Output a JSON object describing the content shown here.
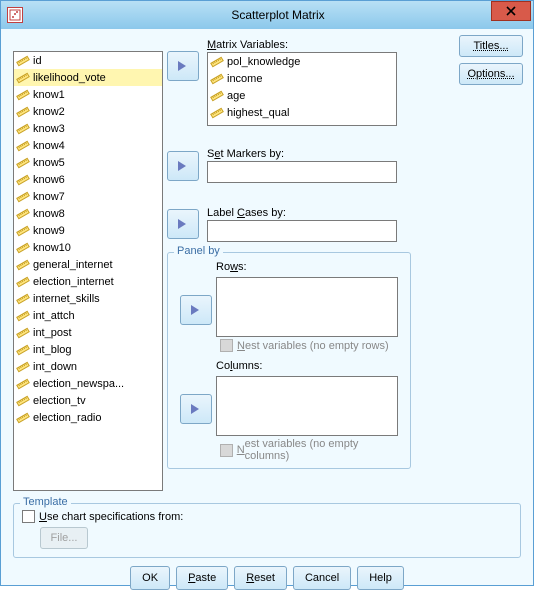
{
  "title": "Scatterplot Matrix",
  "variables": [
    "id",
    "likelihood_vote",
    "know1",
    "know2",
    "know3",
    "know4",
    "know5",
    "know6",
    "know7",
    "know8",
    "know9",
    "know10",
    "general_internet",
    "election_internet",
    "internet_skills",
    "int_attch",
    "int_post",
    "int_blog",
    "int_down",
    "election_newspa...",
    "election_tv",
    "election_radio"
  ],
  "selected_var_index": 1,
  "labels": {
    "matrix": "Matrix Variables:",
    "markers_pre": "S",
    "markers_ul": "e",
    "markers_post": "t Markers by:",
    "cases_pre": "Label ",
    "cases_ul": "C",
    "cases_post": "ases by:",
    "panel": "Panel by",
    "rows": "Ro",
    "rows_ul": "w",
    "rows_post": "s:",
    "nest_rows_pre": "",
    "nest_rows_ul": "N",
    "nest_rows_post": "est variables (no empty rows)",
    "cols": "Co",
    "cols_ul": "l",
    "cols_post": "umns:",
    "nest_cols_pre": "",
    "nest_cols_ul": "N",
    "nest_cols_post": "est variables (no empty columns)",
    "template": "Template",
    "tpl_pre": "",
    "tpl_ul": "U",
    "tpl_post": "se chart specifications from:",
    "file": "File..."
  },
  "matrix_vars": [
    "pol_knowledge",
    "income",
    "age",
    "highest_qual"
  ],
  "side_buttons": {
    "titles": "Titles...",
    "options": "Options..."
  },
  "buttons": {
    "ok": "OK",
    "paste": "Paste",
    "reset": "Reset",
    "cancel": "Cancel",
    "help": "Help"
  }
}
